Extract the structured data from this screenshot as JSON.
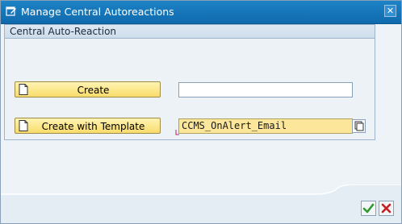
{
  "window": {
    "title": "Manage Central Autoreactions",
    "close_icon": "close-icon"
  },
  "group": {
    "title": "Central Auto-Reaction"
  },
  "buttons": {
    "create_label": "Create",
    "create_with_template_label": "Create with Template",
    "icon": "document-icon"
  },
  "fields": {
    "name_value": "",
    "template_value": "CCMS_OnAlert_Email",
    "template_f4_icon": "copy-icon"
  },
  "footer": {
    "ok_icon": "checkmark-icon",
    "cancel_icon": "cross-icon"
  },
  "colors": {
    "title_bar": "#1078bf",
    "button_yellow": "#f8dc6a",
    "field_highlight": "#fbe69a",
    "ok_green": "#2e9a2e",
    "cancel_red": "#c81e1e"
  }
}
